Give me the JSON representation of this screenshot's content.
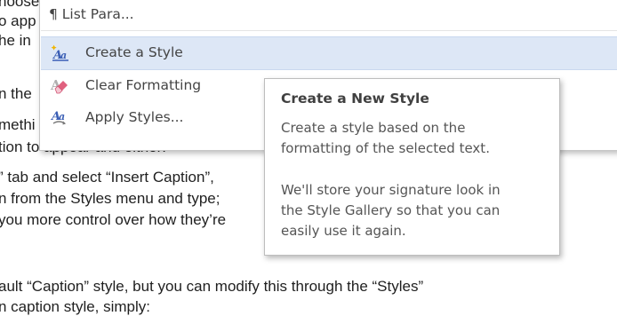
{
  "document": {
    "lines": [
      "hoose",
      "o app",
      "he  in",
      "n the",
      "methi",
      "tion to appear and either:",
      "” tab and select “Insert Caption”,",
      "n from the Styles menu and type;",
      "you more control over how they’re",
      "ault “Caption” style, but you can modify this through the “Styles”",
      "n caption style, simply:"
    ]
  },
  "menu": {
    "items": [
      {
        "label": "¶ List Para...",
        "icon": "paragraph-mark"
      },
      {
        "label": "Create a Style",
        "icon": "create-style-icon",
        "selected": true
      },
      {
        "label": "Clear Formatting",
        "icon": "eraser-icon"
      },
      {
        "label": "Apply Styles...",
        "icon": "apply-styles-icon"
      }
    ]
  },
  "tooltip": {
    "title": "Create a New Style",
    "lines": [
      "Create a style based on the",
      "formatting of the selected text.",
      "We'll store your signature look in",
      "the Style Gallery so that you can",
      "easily use it again."
    ]
  },
  "colors": {
    "selected_bg": "#dde7f6",
    "icon_blue": "#3b5fb5",
    "icon_pink": "#e0607e"
  }
}
